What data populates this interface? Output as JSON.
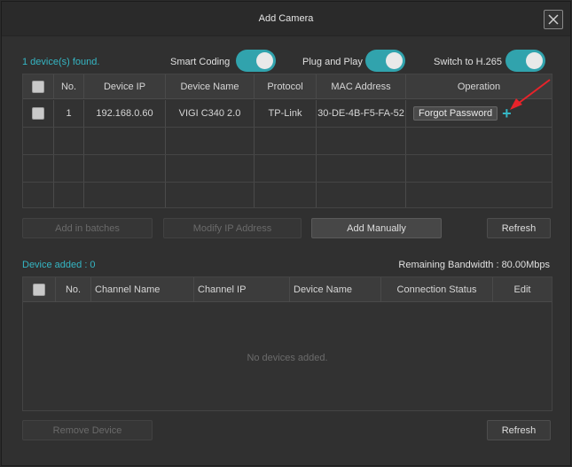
{
  "dialog": {
    "title": "Add Camera"
  },
  "scan": {
    "found_text": "1 device(s) found."
  },
  "toggles": [
    {
      "label": "Smart Coding",
      "on": true
    },
    {
      "label": "Plug and Play",
      "on": true
    },
    {
      "label": "Switch to H.265",
      "on": true
    }
  ],
  "found_table": {
    "headers": [
      "No.",
      "Device IP",
      "Device Name",
      "Protocol",
      "MAC Address",
      "Operation"
    ],
    "rows": [
      {
        "no": "1",
        "ip": "192.168.0.60",
        "name": "VIGI C340 2.0",
        "protocol": "TP-Link",
        "mac": "30-DE-4B-F5-FA-52",
        "forgot_label": "Forgot Password",
        "add_icon": "plus-icon"
      }
    ]
  },
  "actions": {
    "add_batches": "Add in batches",
    "modify_ip": "Modify IP Address",
    "add_manually": "Add Manually",
    "refresh": "Refresh"
  },
  "added": {
    "label": "Device added : 0",
    "bandwidth": "Remaining Bandwidth : 80.00Mbps",
    "headers": [
      "No.",
      "Channel Name",
      "Channel IP",
      "Device Name",
      "Connection Status",
      "Edit"
    ],
    "empty_text": "No devices added.",
    "remove": "Remove Device",
    "refresh": "Refresh"
  },
  "colors": {
    "accent": "#35b6c4",
    "toggle_on": "#31a3ad",
    "annotation": "#e8232a"
  }
}
